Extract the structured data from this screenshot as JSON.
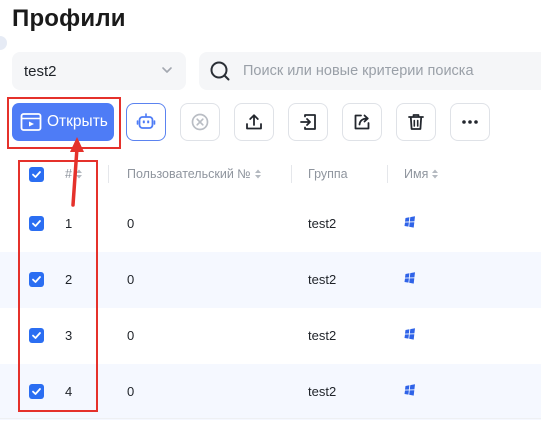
{
  "page": {
    "title": "Профили"
  },
  "group_select": {
    "value": "test2",
    "icon": "chevron-down-icon"
  },
  "search": {
    "placeholder": "Поиск или новые критерии поиска",
    "icon": "search-icon"
  },
  "toolbar": {
    "open_label": "Открыть",
    "buttons": [
      "open-browser-icon",
      "robot-icon",
      "close-circle-icon",
      "upload-icon",
      "import-icon",
      "share-icon",
      "trash-icon",
      "more-icon"
    ]
  },
  "table": {
    "columns": [
      {
        "label": "#",
        "sortable": true
      },
      {
        "label": "Пользовательский №",
        "sortable": true
      },
      {
        "label": "Группа",
        "sortable": false
      },
      {
        "label": "Имя",
        "sortable": true
      }
    ],
    "rows": [
      {
        "checked": true,
        "num": "1",
        "custom_no": "0",
        "group": "test2",
        "os_icon": "windows-icon"
      },
      {
        "checked": true,
        "num": "2",
        "custom_no": "0",
        "group": "test2",
        "os_icon": "windows-icon"
      },
      {
        "checked": true,
        "num": "3",
        "custom_no": "0",
        "group": "test2",
        "os_icon": "windows-icon"
      },
      {
        "checked": true,
        "num": "4",
        "custom_no": "0",
        "group": "test2",
        "os_icon": "windows-icon"
      }
    ],
    "header_checked": true
  },
  "colors": {
    "accent": "#4e7cf6",
    "checkbox": "#2b6ef2",
    "annotation": "#e5312b",
    "row_alt": "#f5f8ff",
    "windows_logo": "#2f63e8"
  }
}
